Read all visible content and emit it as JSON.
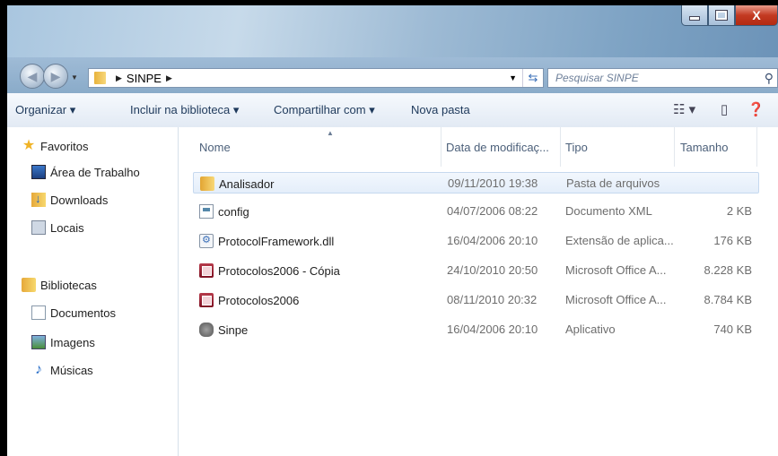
{
  "window": {
    "caption": {
      "minimize": "",
      "maximize": "",
      "close": "X"
    }
  },
  "address": {
    "crumb": "SINPE",
    "search_placeholder": "Pesquisar SINPE"
  },
  "toolbar": {
    "organize": "Organizar ▾",
    "include_library": "Incluir na biblioteca ▾",
    "share": "Compartilhar com ▾",
    "new_folder": "Nova pasta"
  },
  "nav": {
    "favorites": "Favoritos",
    "desktop": "Área de Trabalho",
    "downloads": "Downloads",
    "locais": "Locais",
    "libraries": "Bibliotecas",
    "documents": "Documentos",
    "images": "Imagens",
    "music": "Músicas"
  },
  "columns": {
    "name": "Nome",
    "date": "Data de modificaç...",
    "type": "Tipo",
    "size": "Tamanho"
  },
  "files": [
    {
      "name": "Analisador",
      "date": "09/11/2010 19:38",
      "type": "Pasta de arquivos",
      "size": "",
      "icon": "folder-icon"
    },
    {
      "name": "config",
      "date": "04/07/2006 08:22",
      "type": "Documento XML",
      "size": "2 KB",
      "icon": "xml-file-icon"
    },
    {
      "name": "ProtocolFramework.dll",
      "date": "16/04/2006 20:10",
      "type": "Extensão de aplica...",
      "size": "176 KB",
      "icon": "dll-file-icon"
    },
    {
      "name": "Protocolos2006 - Cópia",
      "date": "24/10/2010 20:50",
      "type": "Microsoft Office A...",
      "size": "8.228 KB",
      "icon": "access-file-icon"
    },
    {
      "name": "Protocolos2006",
      "date": "08/11/2010 20:32",
      "type": "Microsoft Office A...",
      "size": "8.784 KB",
      "icon": "access-file-icon"
    },
    {
      "name": "Sinpe",
      "date": "16/04/2006 20:10",
      "type": "Aplicativo",
      "size": "740 KB",
      "icon": "application-icon"
    }
  ]
}
